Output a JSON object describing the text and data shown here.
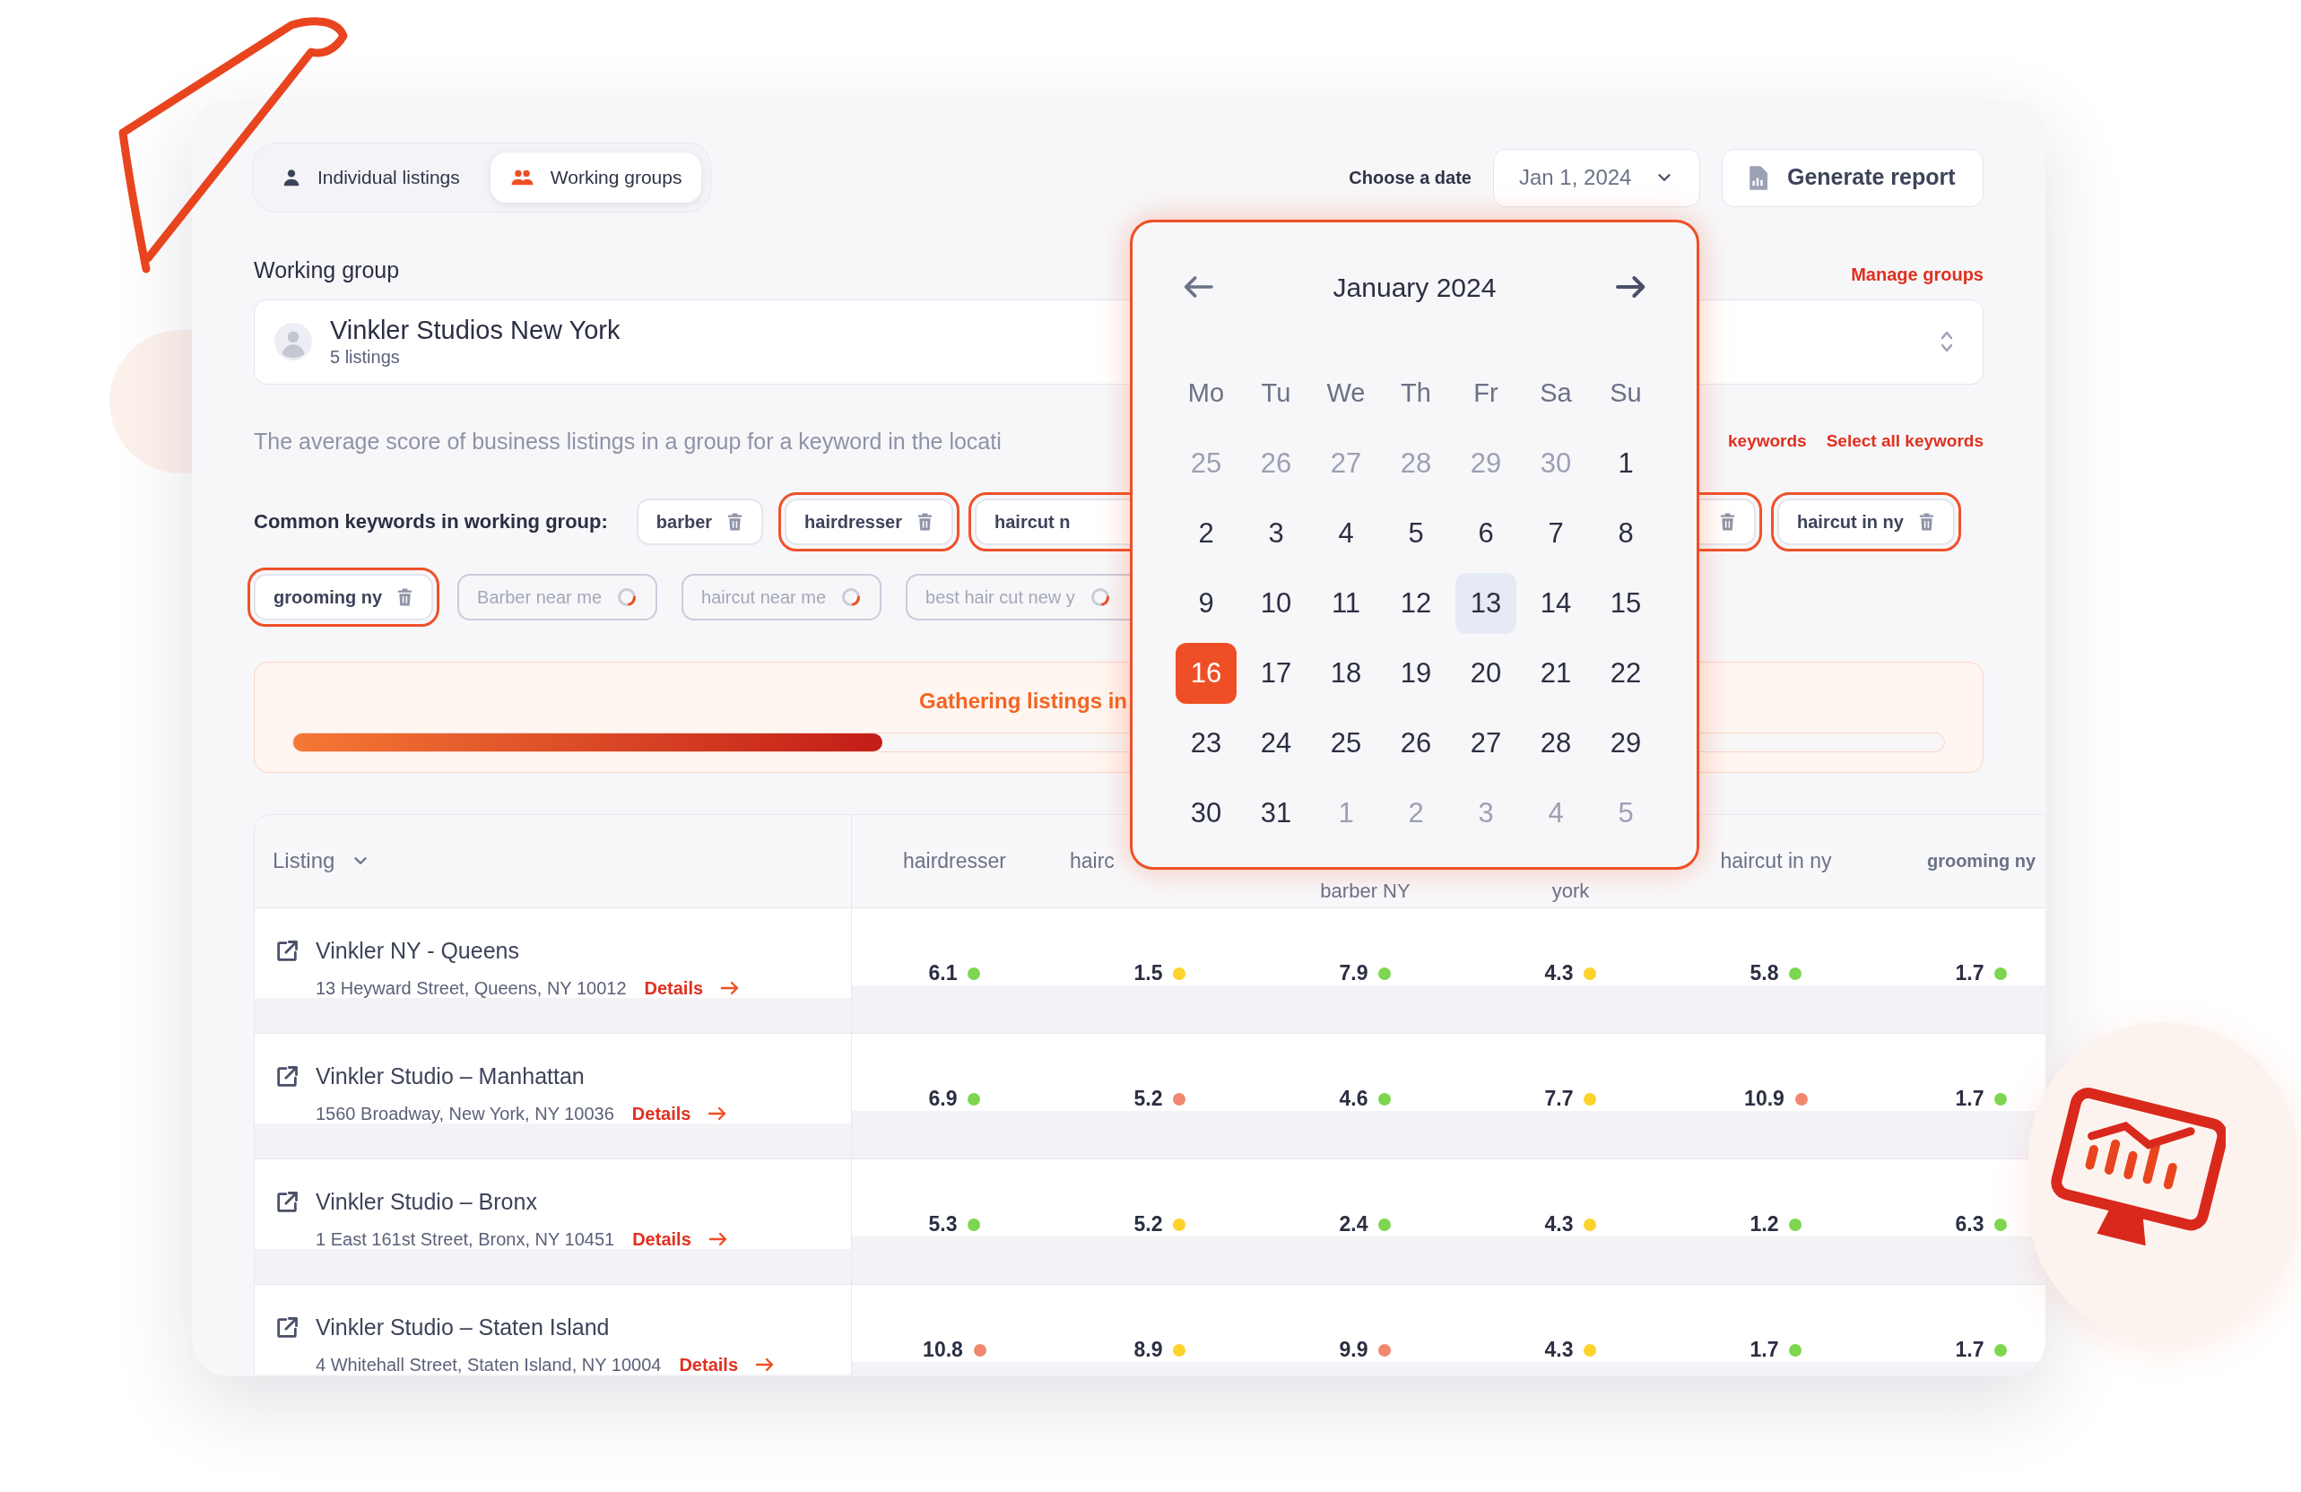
{
  "tabs": [
    {
      "label": "Individual listings",
      "selected": false
    },
    {
      "label": "Working groups",
      "selected": true
    }
  ],
  "date_picker": {
    "label": "Choose a date",
    "value": "Jan 1, 2024"
  },
  "generate_button": "Generate report",
  "working_group": {
    "label": "Working group",
    "manage_link": "Manage groups",
    "name": "Vinkler Studios New York",
    "count": "5 listings"
  },
  "description": "The average score of business listings in a group for a keyword in the locati",
  "keyword_links": [
    "keywords",
    "Select all keywords"
  ],
  "keywords_label": "Common keywords in working group:",
  "keyword_rows": [
    [
      {
        "kind": "keyword",
        "label": "barber",
        "highlighted": false
      },
      {
        "kind": "keyword",
        "label": "hairdresser",
        "highlighted": true
      },
      {
        "kind": "partial",
        "label": "haircut n",
        "highlighted": true
      },
      {
        "kind": "keyword",
        "highlighted": true
      },
      {
        "kind": "keyword",
        "label": "haircut in ny",
        "highlighted": true
      }
    ],
    [
      {
        "kind": "keyword",
        "label": "grooming ny",
        "highlighted": true
      },
      {
        "kind": "pending",
        "label": "Barber near me",
        "highlighted": false
      },
      {
        "kind": "pending",
        "label": "haircut near me",
        "highlighted": false
      },
      {
        "kind": "pending",
        "label": "best hair cut new y",
        "highlighted": false
      }
    ]
  ],
  "progress": {
    "label": "Gathering listings in",
    "level": 0.357
  },
  "table": {
    "columns": [
      "Listing",
      "hairdresser",
      "hairc",
      "barber NY",
      "york",
      "haircut in ny",
      "grooming ny"
    ],
    "rows": [
      {
        "name": "Vinkler NY - Queens",
        "address": "13 Heyward Street, Queens, NY 10012",
        "link": "Details",
        "scores": [
          {
            "value": "6.1",
            "color": "#7dd64f"
          },
          {
            "value": "1.5",
            "color": "#fdd22b"
          },
          {
            "value": "7.9",
            "color": "#7dd64f"
          },
          {
            "value": "4.3",
            "color": "#fdd22b"
          },
          {
            "value": "5.8",
            "color": "#7dd64f"
          },
          {
            "value": "1.7",
            "color": "#7dd64f"
          }
        ]
      },
      {
        "name": "Vinkler Studio – Manhattan",
        "address": "1560 Broadway, New York, NY 10036",
        "link": "Details",
        "scores": [
          {
            "value": "6.9",
            "color": "#7dd64f"
          },
          {
            "value": "5.2",
            "color": "#f2876f"
          },
          {
            "value": "4.6",
            "color": "#7dd64f"
          },
          {
            "value": "7.7",
            "color": "#fdd22b"
          },
          {
            "value": "10.9",
            "color": "#f2876f"
          },
          {
            "value": "1.7",
            "color": "#7dd64f"
          }
        ]
      },
      {
        "name": "Vinkler Studio – Bronx",
        "address": "1 East 161st Street, Bronx, NY 10451",
        "link": "Details",
        "scores": [
          {
            "value": "5.3",
            "color": "#7dd64f"
          },
          {
            "value": "5.2",
            "color": "#fdd22b"
          },
          {
            "value": "2.4",
            "color": "#7dd64f"
          },
          {
            "value": "4.3",
            "color": "#fdd22b"
          },
          {
            "value": "1.2",
            "color": "#7dd64f"
          },
          {
            "value": "6.3",
            "color": "#7dd64f"
          }
        ]
      },
      {
        "name": "Vinkler Studio – Staten Island",
        "address": "4 Whitehall Street, Staten Island, NY 10004",
        "link": "Details",
        "scores": [
          {
            "value": "10.8",
            "color": "#f2876f"
          },
          {
            "value": "8.9",
            "color": "#fdd22b"
          },
          {
            "value": "9.9",
            "color": "#f2876f"
          },
          {
            "value": "4.3",
            "color": "#fdd22b"
          },
          {
            "value": "1.7",
            "color": "#7dd64f"
          },
          {
            "value": "1.7",
            "color": "#7dd64f"
          }
        ]
      }
    ]
  },
  "calendar": {
    "title": "January 2024",
    "weekdays": [
      "Mo",
      "Tu",
      "We",
      "Th",
      "Fr",
      "Sa",
      "Su"
    ],
    "days": [
      {
        "label": "25",
        "outside": true,
        "today": false,
        "selected": false
      },
      {
        "label": "26",
        "outside": true,
        "today": false,
        "selected": false
      },
      {
        "label": "27",
        "outside": true,
        "today": false,
        "selected": false
      },
      {
        "label": "28",
        "outside": true,
        "today": false,
        "selected": false
      },
      {
        "label": "29",
        "outside": true,
        "today": false,
        "selected": false
      },
      {
        "label": "30",
        "outside": true,
        "today": false,
        "selected": false
      },
      {
        "label": "1",
        "outside": false,
        "today": false,
        "selected": false
      },
      {
        "label": "2",
        "outside": false,
        "today": false,
        "selected": false
      },
      {
        "label": "3",
        "outside": false,
        "today": false,
        "selected": false
      },
      {
        "label": "4",
        "outside": false,
        "today": false,
        "selected": false
      },
      {
        "label": "5",
        "outside": false,
        "today": false,
        "selected": false
      },
      {
        "label": "6",
        "outside": false,
        "today": false,
        "selected": false
      },
      {
        "label": "7",
        "outside": false,
        "today": false,
        "selected": false
      },
      {
        "label": "8",
        "outside": false,
        "today": false,
        "selected": false
      },
      {
        "label": "9",
        "outside": false,
        "today": false,
        "selected": false
      },
      {
        "label": "10",
        "outside": false,
        "today": false,
        "selected": false
      },
      {
        "label": "11",
        "outside": false,
        "today": false,
        "selected": false
      },
      {
        "label": "12",
        "outside": false,
        "today": false,
        "selected": false
      },
      {
        "label": "13",
        "outside": false,
        "today": true,
        "selected": false
      },
      {
        "label": "14",
        "outside": false,
        "today": false,
        "selected": false
      },
      {
        "label": "15",
        "outside": false,
        "today": false,
        "selected": false
      },
      {
        "label": "16",
        "outside": false,
        "today": false,
        "selected": true
      },
      {
        "label": "17",
        "outside": false,
        "today": false,
        "selected": false
      },
      {
        "label": "18",
        "outside": false,
        "today": false,
        "selected": false
      },
      {
        "label": "19",
        "outside": false,
        "today": false,
        "selected": false
      },
      {
        "label": "20",
        "outside": false,
        "today": false,
        "selected": false
      },
      {
        "label": "21",
        "outside": false,
        "today": false,
        "selected": false
      },
      {
        "label": "22",
        "outside": false,
        "today": false,
        "selected": false
      },
      {
        "label": "23",
        "outside": false,
        "today": false,
        "selected": false
      },
      {
        "label": "24",
        "outside": false,
        "today": false,
        "selected": false
      },
      {
        "label": "25",
        "outside": false,
        "today": false,
        "selected": false
      },
      {
        "label": "26",
        "outside": false,
        "today": false,
        "selected": false
      },
      {
        "label": "27",
        "outside": false,
        "today": false,
        "selected": false
      },
      {
        "label": "28",
        "outside": false,
        "today": false,
        "selected": false
      },
      {
        "label": "29",
        "outside": false,
        "today": false,
        "selected": false
      },
      {
        "label": "30",
        "outside": false,
        "today": false,
        "selected": false
      },
      {
        "label": "31",
        "outside": false,
        "today": false,
        "selected": false
      },
      {
        "label": "1",
        "outside": true,
        "today": false,
        "selected": false
      },
      {
        "label": "2",
        "outside": true,
        "today": false,
        "selected": false
      },
      {
        "label": "3",
        "outside": true,
        "today": false,
        "selected": false
      },
      {
        "label": "4",
        "outside": true,
        "today": false,
        "selected": false
      },
      {
        "label": "5",
        "outside": true,
        "today": false,
        "selected": false
      }
    ]
  }
}
